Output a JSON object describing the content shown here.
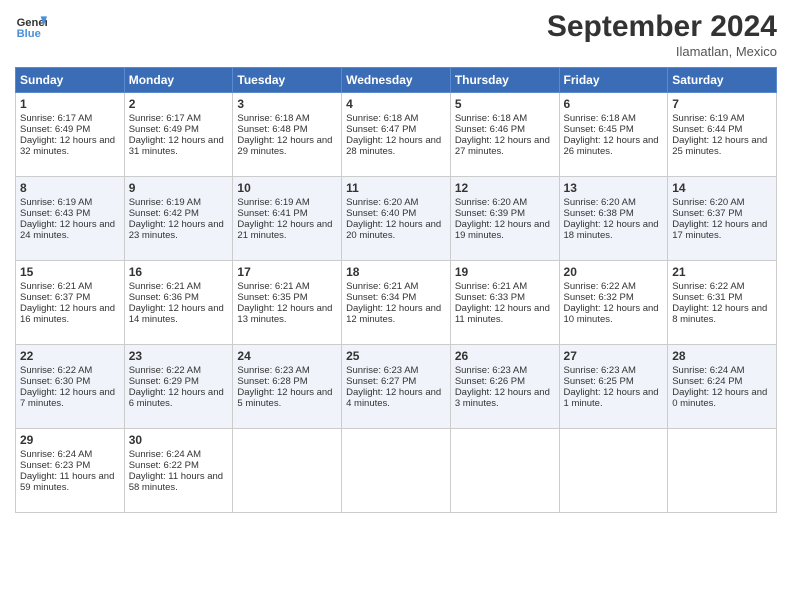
{
  "header": {
    "logo_line1": "General",
    "logo_line2": "Blue",
    "month": "September 2024",
    "location": "Ilamatlan, Mexico"
  },
  "weekdays": [
    "Sunday",
    "Monday",
    "Tuesday",
    "Wednesday",
    "Thursday",
    "Friday",
    "Saturday"
  ],
  "weeks": [
    [
      {
        "day": "1",
        "sunrise": "6:17 AM",
        "sunset": "6:49 PM",
        "daylight": "12 hours and 32 minutes."
      },
      {
        "day": "2",
        "sunrise": "6:17 AM",
        "sunset": "6:49 PM",
        "daylight": "12 hours and 31 minutes."
      },
      {
        "day": "3",
        "sunrise": "6:18 AM",
        "sunset": "6:48 PM",
        "daylight": "12 hours and 29 minutes."
      },
      {
        "day": "4",
        "sunrise": "6:18 AM",
        "sunset": "6:47 PM",
        "daylight": "12 hours and 28 minutes."
      },
      {
        "day": "5",
        "sunrise": "6:18 AM",
        "sunset": "6:46 PM",
        "daylight": "12 hours and 27 minutes."
      },
      {
        "day": "6",
        "sunrise": "6:18 AM",
        "sunset": "6:45 PM",
        "daylight": "12 hours and 26 minutes."
      },
      {
        "day": "7",
        "sunrise": "6:19 AM",
        "sunset": "6:44 PM",
        "daylight": "12 hours and 25 minutes."
      }
    ],
    [
      {
        "day": "8",
        "sunrise": "6:19 AM",
        "sunset": "6:43 PM",
        "daylight": "12 hours and 24 minutes."
      },
      {
        "day": "9",
        "sunrise": "6:19 AM",
        "sunset": "6:42 PM",
        "daylight": "12 hours and 23 minutes."
      },
      {
        "day": "10",
        "sunrise": "6:19 AM",
        "sunset": "6:41 PM",
        "daylight": "12 hours and 21 minutes."
      },
      {
        "day": "11",
        "sunrise": "6:20 AM",
        "sunset": "6:40 PM",
        "daylight": "12 hours and 20 minutes."
      },
      {
        "day": "12",
        "sunrise": "6:20 AM",
        "sunset": "6:39 PM",
        "daylight": "12 hours and 19 minutes."
      },
      {
        "day": "13",
        "sunrise": "6:20 AM",
        "sunset": "6:38 PM",
        "daylight": "12 hours and 18 minutes."
      },
      {
        "day": "14",
        "sunrise": "6:20 AM",
        "sunset": "6:37 PM",
        "daylight": "12 hours and 17 minutes."
      }
    ],
    [
      {
        "day": "15",
        "sunrise": "6:21 AM",
        "sunset": "6:37 PM",
        "daylight": "12 hours and 16 minutes."
      },
      {
        "day": "16",
        "sunrise": "6:21 AM",
        "sunset": "6:36 PM",
        "daylight": "12 hours and 14 minutes."
      },
      {
        "day": "17",
        "sunrise": "6:21 AM",
        "sunset": "6:35 PM",
        "daylight": "12 hours and 13 minutes."
      },
      {
        "day": "18",
        "sunrise": "6:21 AM",
        "sunset": "6:34 PM",
        "daylight": "12 hours and 12 minutes."
      },
      {
        "day": "19",
        "sunrise": "6:21 AM",
        "sunset": "6:33 PM",
        "daylight": "12 hours and 11 minutes."
      },
      {
        "day": "20",
        "sunrise": "6:22 AM",
        "sunset": "6:32 PM",
        "daylight": "12 hours and 10 minutes."
      },
      {
        "day": "21",
        "sunrise": "6:22 AM",
        "sunset": "6:31 PM",
        "daylight": "12 hours and 8 minutes."
      }
    ],
    [
      {
        "day": "22",
        "sunrise": "6:22 AM",
        "sunset": "6:30 PM",
        "daylight": "12 hours and 7 minutes."
      },
      {
        "day": "23",
        "sunrise": "6:22 AM",
        "sunset": "6:29 PM",
        "daylight": "12 hours and 6 minutes."
      },
      {
        "day": "24",
        "sunrise": "6:23 AM",
        "sunset": "6:28 PM",
        "daylight": "12 hours and 5 minutes."
      },
      {
        "day": "25",
        "sunrise": "6:23 AM",
        "sunset": "6:27 PM",
        "daylight": "12 hours and 4 minutes."
      },
      {
        "day": "26",
        "sunrise": "6:23 AM",
        "sunset": "6:26 PM",
        "daylight": "12 hours and 3 minutes."
      },
      {
        "day": "27",
        "sunrise": "6:23 AM",
        "sunset": "6:25 PM",
        "daylight": "12 hours and 1 minute."
      },
      {
        "day": "28",
        "sunrise": "6:24 AM",
        "sunset": "6:24 PM",
        "daylight": "12 hours and 0 minutes."
      }
    ],
    [
      {
        "day": "29",
        "sunrise": "6:24 AM",
        "sunset": "6:23 PM",
        "daylight": "11 hours and 59 minutes."
      },
      {
        "day": "30",
        "sunrise": "6:24 AM",
        "sunset": "6:22 PM",
        "daylight": "11 hours and 58 minutes."
      },
      null,
      null,
      null,
      null,
      null
    ]
  ]
}
